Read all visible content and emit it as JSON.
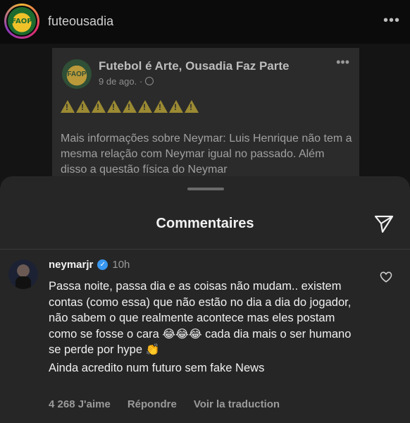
{
  "post": {
    "username": "futeousadia",
    "avatar_text": "FAOP",
    "more_icon": "more-horizontal-icon"
  },
  "embedded": {
    "logo_text": "FAOP",
    "title": "Futebol é Arte, Ousadia Faz Parte",
    "date": "9 de ago. ·",
    "warnings": 9,
    "text": "Mais informações sobre Neymar: Luis Henrique não tem a mesma relação com Neymar igual no passado. Além disso a questão física do Neymar"
  },
  "sheet": {
    "title": "Commentaires",
    "send_icon": "send-icon"
  },
  "comment": {
    "username": "neymarjr",
    "time": "10h",
    "line1": "Passa noite, passa dia e as coisas não mudam.. existem contas (como essa) que não estão no dia a dia do jogador, não sabem o que realmente acontece mas eles postam como se fosse o cara",
    "emojis": "😂😂😂",
    "line1b": " cada dia mais o ser humano se perde por hype ",
    "emoji_clap": "👏",
    "line2": "Ainda acredito num futuro sem fake News",
    "likes": "4 268 J'aime",
    "reply": "Répondre",
    "translate": "Voir la traduction"
  },
  "colors": {
    "sheet_bg": "#262626",
    "verified": "#3897f0"
  }
}
